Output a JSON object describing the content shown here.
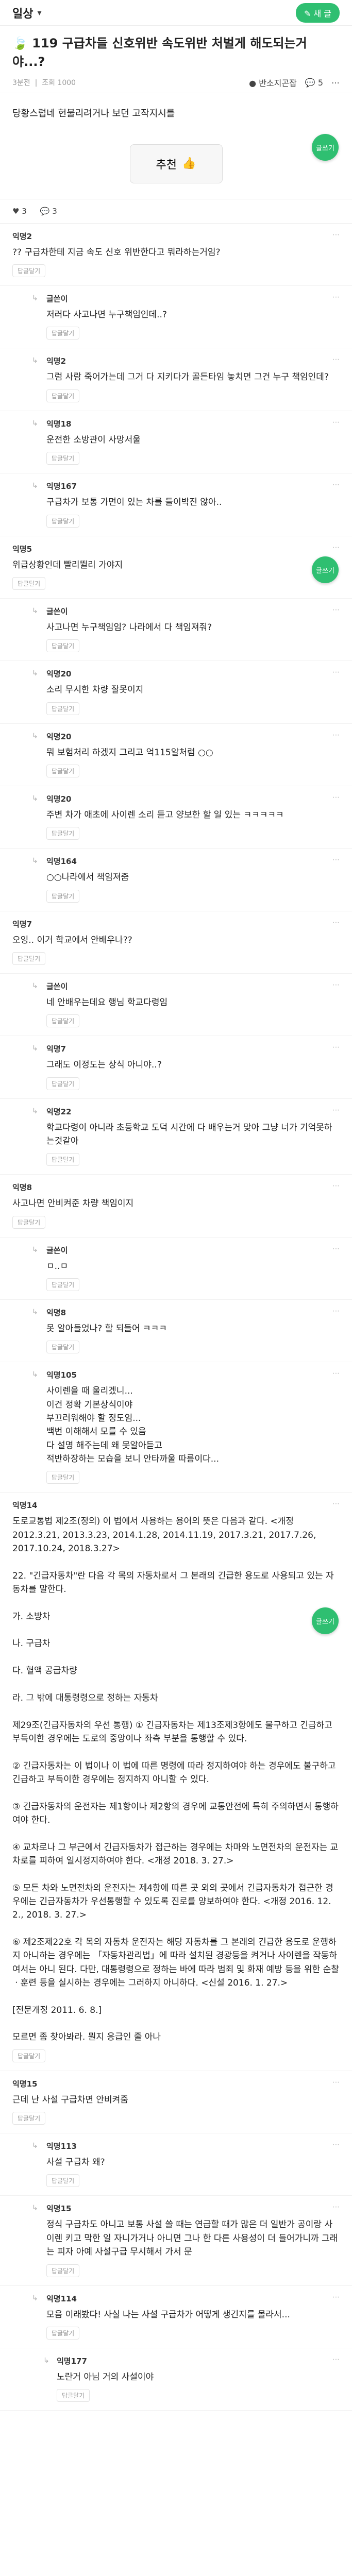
{
  "header": {
    "board": "일상",
    "write_label": "새 글"
  },
  "post": {
    "title": "119 구급차들 신호위반 속도위반 처벌게 해도되는거야...?",
    "time": "3분전",
    "views": "조회 1000",
    "author": "반소지곤잡",
    "comment_count": "5",
    "body": "당황스럽네 헌불리려거나 보던 고작지시를",
    "recommend_label": "추천",
    "likes": "3",
    "replies": "3"
  },
  "comments": [
    {
      "nick": "익명2",
      "text": "?? 구급차한테 지금 속도 신호 위반한다고 뭐라하는거임?",
      "pill": "답글달기",
      "level": 0
    },
    {
      "nick": "글쓴이",
      "text": "저러다 사고나면 누구책임인데..?",
      "pill": "답글달기",
      "level": 1
    },
    {
      "nick": "익명2",
      "text": "그럼 사람 죽어가는데 그거 다 지키다가 골든타임 놓치면 그건 누구 책임인데?",
      "pill": "답글달기",
      "level": 1
    },
    {
      "nick": "익명18",
      "text": "운전한 소방관이 사망서울",
      "pill": "답글달기",
      "level": 1
    },
    {
      "nick": "익명167",
      "text": "구급차가 보통 가면이 있는 차를 들이박진 않아..",
      "pill": "답글달기",
      "level": 1
    },
    {
      "nick": "익명5",
      "text": "위급상황인데 빨리뛸리 가야지",
      "pill": "답글달기",
      "level": 0
    },
    {
      "nick": "글쓴이",
      "text": "사고나면 누구책임임? 나라에서 다 책임져줘?",
      "pill": "답글달기",
      "level": 1
    },
    {
      "nick": "익명20",
      "text": "소리 무시한 차량 잘못이지",
      "pill": "답글달기",
      "level": 1
    },
    {
      "nick": "익명20",
      "text": "뭐 보험처리 하겠지 그리고 억115알처럼 ○○",
      "pill": "답글달기",
      "level": 1
    },
    {
      "nick": "익명20",
      "text": "주변 차가 애초에 사이렌 소리 듣고 양보한 할 일 있는 ㅋㅋㅋㅋㅋ",
      "pill": "답글달기",
      "level": 1
    },
    {
      "nick": "익명164",
      "text": "○○나라에서 책임져줌",
      "pill": "답글달기",
      "level": 1
    },
    {
      "nick": "익명7",
      "text": "오잉.. 이거 학교에서 안배우나??",
      "pill": "답글달기",
      "level": 0
    },
    {
      "nick": "글쓴이",
      "text": "네 안배우는데요 행님 학교다령임",
      "pill": "답글달기",
      "level": 1
    },
    {
      "nick": "익명7",
      "text": "그래도 이정도는 상식 아니야..?",
      "pill": "답글달기",
      "level": 1
    },
    {
      "nick": "익명22",
      "text": "학교다령이 아니라 초등학교 도덕 시간에 다 배우는거 맞아 그냥 너가 기억못하는것같아",
      "pill": "답글달기",
      "level": 1
    },
    {
      "nick": "익명8",
      "text": "사고나면 안비켜준 차량 책임이지",
      "pill": "답글달기",
      "level": 0
    },
    {
      "nick": "글쓴이",
      "text": "ㅁ..ㅁ",
      "pill": "답글달기",
      "level": 1
    },
    {
      "nick": "익명8",
      "text": "못 알아들었나? 할 되들어 ㅋㅋㅋ",
      "pill": "답글달기",
      "level": 1
    },
    {
      "nick": "익명105",
      "text": "사이렌을 때 울리겠니...\n이건 정확 기본상식이야\n부끄러워해야 할 정도임...\n백번 이해해서 모를 수 있음\n다 설명 해주는데 왜 못알아듣고 \n적반하장하는 모습을 보니 안타까울 따름이다...",
      "pill": "답글달기",
      "level": 1
    },
    {
      "nick": "익명14",
      "text": "도로교통법 제2조(정의) 이 법에서 사용하는 용어의 뜻은 다음과 같다. <개정 2012.3.21, 2013.3.23, 2014.1.28, 2014.11.19, 2017.3.21, 2017.7.26, 2017.10.24, 2018.3.27>\n\n22. \"긴급자동차\"란 다음 각 목의 자동차로서 그 본래의 긴급한 용도로 사용되고 있는 자동차를 말한다.\n\n가. 소방차\n\n나. 구급차\n\n다. 혈액 공급차량\n\n라. 그 밖에 대통령령으로 정하는 자동차\n\n제29조(긴급자동차의 우선 통행) ① 긴급자동차는 제13조제3항에도 불구하고 긴급하고 부득이한 경우에는 도로의 중앙이나 좌측 부분을 통행할 수 있다.\n\n② 긴급자동차는 이 법이나 이 법에 따른 명령에 따라 정지하여야 하는 경우에도 불구하고 긴급하고 부득이한 경우에는 정지하지 아니할 수 있다.\n\n③ 긴급자동차의 운전자는 제1항이나 제2항의 경우에 교통안전에 특히 주의하면서 통행하여야 한다.\n\n④ 교차로나 그 부근에서 긴급자동차가 접근하는 경우에는 차마와 노면전차의 운전자는 교차로를 피하여 일시정지하여야 한다. <개정 2018. 3. 27.>\n\n⑤ 모든 차와 노면전차의 운전자는 제4항에 따른 곳 외의 곳에서 긴급자동차가 접근한 경우에는 긴급자동차가 우선통행할 수 있도록 진로를 양보하여야 한다. <개정 2016. 12. 2., 2018. 3. 27.>\n\n⑥ 제2조제22호 각 목의 자동차 운전자는 해당 자동차를 그 본래의 긴급한 용도로 운행하지 아니하는 경우에는 「자동차관리법」에 따라 설치된 경광등을 켜거나 사이렌을 작동하여서는 아니 된다. 다만, 대통령령으로 정하는 바에 따라 범죄 및 화재 예방 등을 위한 순찰ㆍ훈련 등을 실시하는 경우에는 그러하지 아니하다. <신설 2016. 1. 27.>\n\n[전문개정 2011. 6. 8.]\n\n모르면 좀 찾아봐라. 뭔지 응급인 줄 아나",
      "pill": "답글달기",
      "level": 0
    },
    {
      "nick": "익명15",
      "text": "근데 난 사설 구급차면 안비켜줌",
      "pill": "답글달기",
      "level": 0
    },
    {
      "nick": "익명113",
      "text": "사설 구급차 왜?",
      "pill": "답글달기",
      "level": 1
    },
    {
      "nick": "익명15",
      "text": "정식 구급차도 아니고 보통 사설 쓸 때는 연급할 때가 많은 더 일반가 공이랑 사이렌 키고 막한 일 자니가거나 아니면 그나 한 다른 사용성이 더 들어가니까 그래는 피자 아예 사설구급 무시해서 가서 문",
      "pill": "답글달기",
      "level": 1
    },
    {
      "nick": "익명114",
      "text": "모음 이래봤다! 사실 나는 사설 구급차가 어떻게 생긴지를 몰라서...",
      "pill": "답글달기",
      "level": 1
    },
    {
      "nick": "익명177",
      "text": "노란거 아님 거의 사설이야",
      "pill": "답글달기",
      "level": 2
    }
  ],
  "fab_label": "글쓰기"
}
